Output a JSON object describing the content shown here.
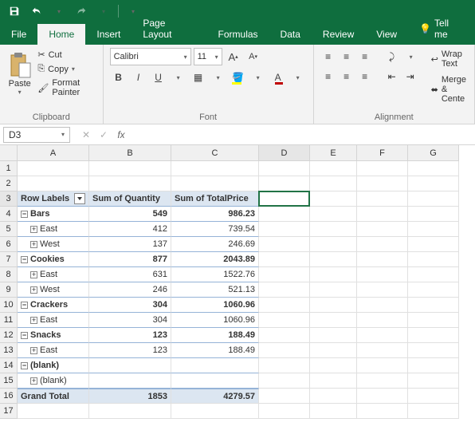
{
  "titlebar": {
    "save": "save",
    "undo": "undo",
    "redo": "redo"
  },
  "tabs": {
    "file": "File",
    "home": "Home",
    "insert": "Insert",
    "pagelayout": "Page Layout",
    "formulas": "Formulas",
    "data": "Data",
    "review": "Review",
    "view": "View",
    "tellme": "Tell me"
  },
  "ribbon": {
    "clipboard": {
      "label": "Clipboard",
      "paste": "Paste",
      "cut": "Cut",
      "copy": "Copy",
      "format": "Format Painter"
    },
    "font": {
      "label": "Font",
      "name": "Calibri",
      "size": "11"
    },
    "alignment": {
      "label": "Alignment",
      "wrap": "Wrap Text",
      "merge": "Merge & Cente"
    }
  },
  "namebox": "D3",
  "columns": [
    "A",
    "B",
    "C",
    "D",
    "E",
    "F",
    "G"
  ],
  "rowcount": 17,
  "pivot": {
    "hdr": {
      "rowlabels": "Row Labels",
      "q": "Sum of Quantity",
      "p": "Sum of TotalPrice"
    },
    "rows": [
      {
        "label": "Bars",
        "q": "549",
        "p": "986.23",
        "lvl": 0,
        "exp": "−"
      },
      {
        "label": "East",
        "q": "412",
        "p": "739.54",
        "lvl": 1,
        "exp": "+"
      },
      {
        "label": "West",
        "q": "137",
        "p": "246.69",
        "lvl": 1,
        "exp": "+"
      },
      {
        "label": "Cookies",
        "q": "877",
        "p": "2043.89",
        "lvl": 0,
        "exp": "−"
      },
      {
        "label": "East",
        "q": "631",
        "p": "1522.76",
        "lvl": 1,
        "exp": "+"
      },
      {
        "label": "West",
        "q": "246",
        "p": "521.13",
        "lvl": 1,
        "exp": "+"
      },
      {
        "label": "Crackers",
        "q": "304",
        "p": "1060.96",
        "lvl": 0,
        "exp": "−"
      },
      {
        "label": "East",
        "q": "304",
        "p": "1060.96",
        "lvl": 1,
        "exp": "+"
      },
      {
        "label": "Snacks",
        "q": "123",
        "p": "188.49",
        "lvl": 0,
        "exp": "−"
      },
      {
        "label": "East",
        "q": "123",
        "p": "188.49",
        "lvl": 1,
        "exp": "+"
      },
      {
        "label": "(blank)",
        "q": "",
        "p": "",
        "lvl": 0,
        "exp": "−"
      },
      {
        "label": "(blank)",
        "q": "",
        "p": "",
        "lvl": 1,
        "exp": "+"
      }
    ],
    "grandtotal": {
      "label": "Grand Total",
      "q": "1853",
      "p": "4279.57"
    }
  }
}
